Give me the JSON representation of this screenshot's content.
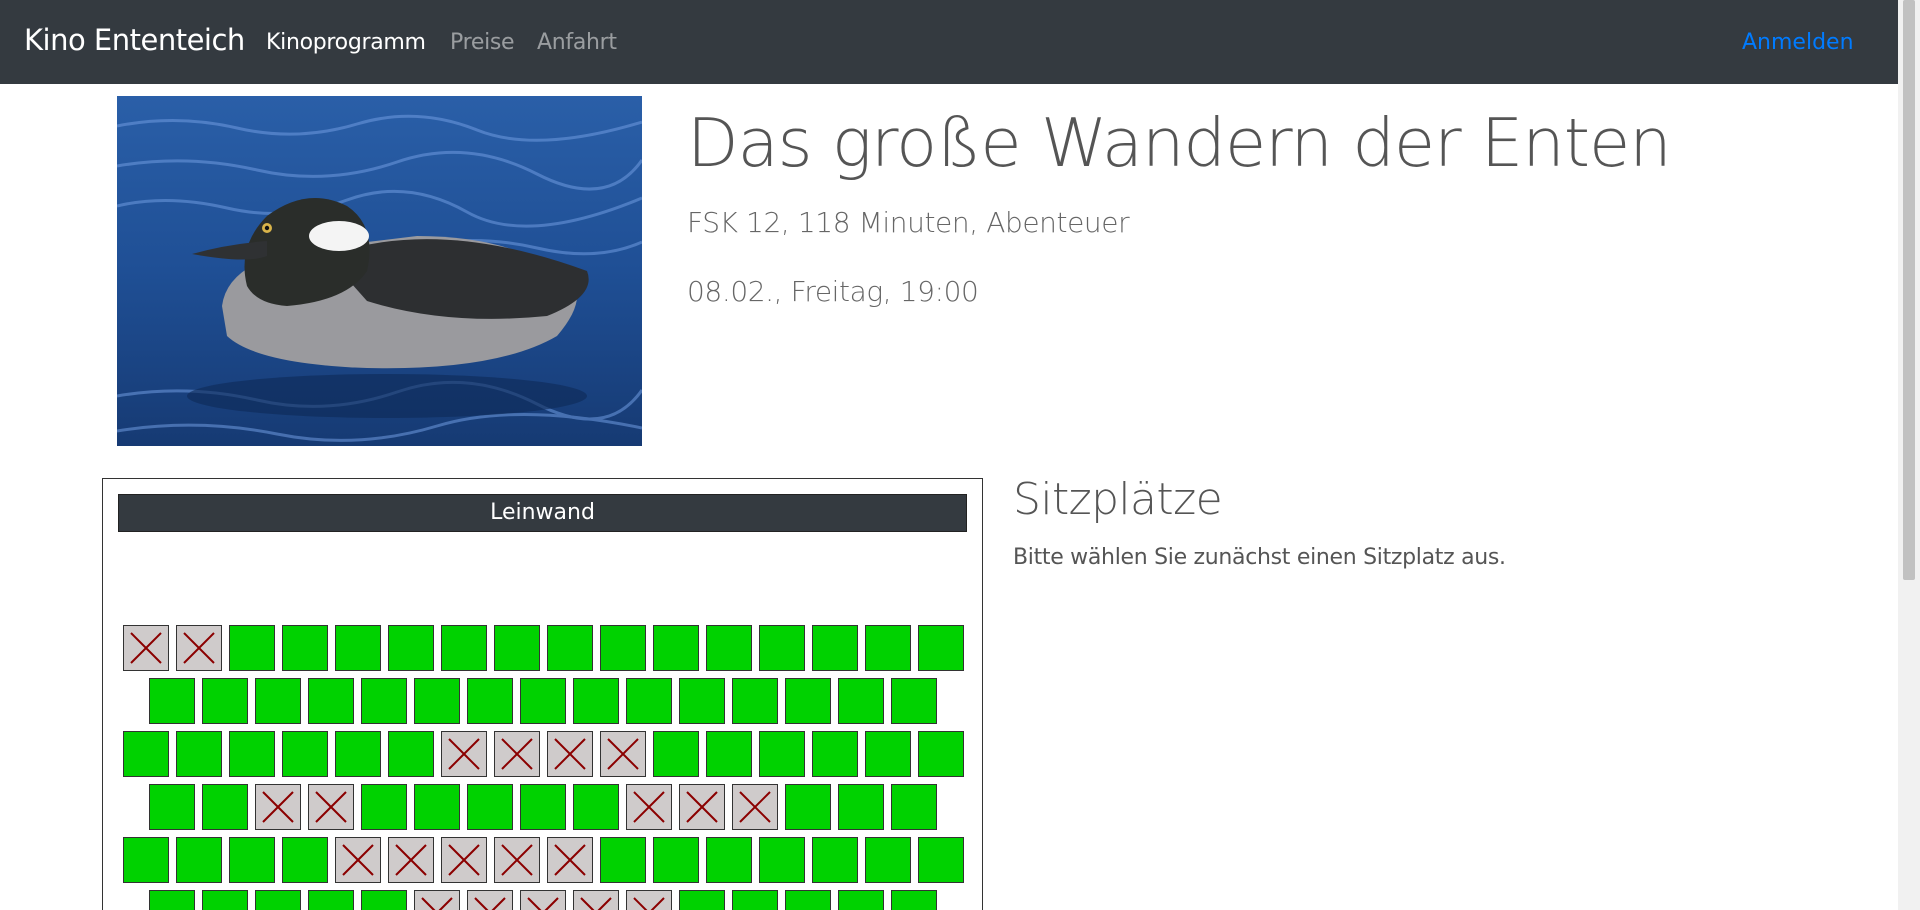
{
  "nav": {
    "brand": "Kino Ententeich",
    "links": [
      {
        "label": "Kinoprogramm",
        "active": true
      },
      {
        "label": "Preise",
        "active": false
      },
      {
        "label": "Anfahrt",
        "active": false
      }
    ],
    "login": "Anmelden"
  },
  "movie": {
    "title": "Das große Wandern der Enten",
    "meta": "FSK 12, 118 Minuten, Abenteuer",
    "showtime": "08.02., Freitag, 19:00",
    "poster_icon": "duck-photo"
  },
  "hall": {
    "screen_label": "Leinwand",
    "rows": [
      {
        "offset": false,
        "seats": [
          "taken",
          "taken",
          "free",
          "free",
          "free",
          "free",
          "free",
          "free",
          "free",
          "free",
          "free",
          "free",
          "free",
          "free",
          "free",
          "free"
        ]
      },
      {
        "offset": true,
        "seats": [
          "free",
          "free",
          "free",
          "free",
          "free",
          "free",
          "free",
          "free",
          "free",
          "free",
          "free",
          "free",
          "free",
          "free",
          "free"
        ]
      },
      {
        "offset": false,
        "seats": [
          "free",
          "free",
          "free",
          "free",
          "free",
          "free",
          "taken",
          "taken",
          "taken",
          "taken",
          "free",
          "free",
          "free",
          "free",
          "free",
          "free"
        ]
      },
      {
        "offset": true,
        "seats": [
          "free",
          "free",
          "taken",
          "taken",
          "free",
          "free",
          "free",
          "free",
          "free",
          "taken",
          "taken",
          "taken",
          "free",
          "free",
          "free"
        ]
      },
      {
        "offset": false,
        "seats": [
          "free",
          "free",
          "free",
          "free",
          "taken",
          "taken",
          "taken",
          "taken",
          "taken",
          "free",
          "free",
          "free",
          "free",
          "free",
          "free",
          "free"
        ]
      },
      {
        "offset": true,
        "seats": [
          "free",
          "free",
          "free",
          "free",
          "free",
          "taken",
          "taken",
          "taken",
          "taken",
          "taken",
          "free",
          "free",
          "free",
          "free",
          "free"
        ]
      }
    ]
  },
  "seats_panel": {
    "title": "Sitzplätze",
    "hint": "Bitte wählen Sie zunächst einen Sitzplatz aus."
  },
  "colors": {
    "navbar": "#343a40",
    "seat_free": "#00d200",
    "seat_taken": "#cfcbcb",
    "cross": "#8b0000",
    "login_link": "#007bff"
  }
}
